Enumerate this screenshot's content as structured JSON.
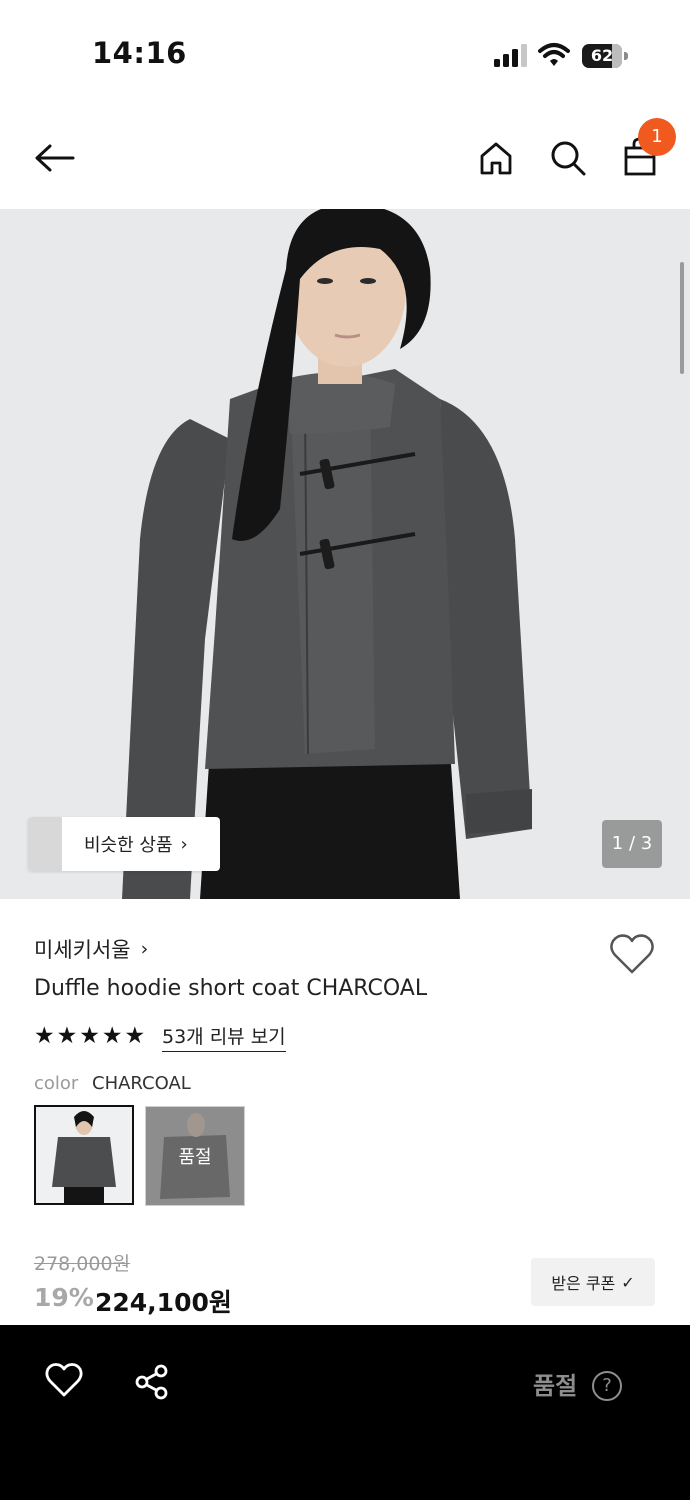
{
  "status_bar": {
    "time": "14:16",
    "battery": "62"
  },
  "header": {
    "cart_count": "1"
  },
  "gallery": {
    "similar_label": "비슷한 상품",
    "page_indicator": "1 / 3"
  },
  "product": {
    "brand": "미세키서울",
    "title": "Duffle hoodie short coat CHARCOAL",
    "rating": 5,
    "review_link": "53개 리뷰 보기",
    "color_label": "color",
    "color_value": "CHARCOAL",
    "swatch_soldout_label": "품절"
  },
  "price": {
    "original": "278,000원",
    "discount": "19%",
    "sale": "224,100원",
    "coupon_label": "받은 쿠폰"
  },
  "bottom_bar": {
    "status": "품절",
    "help": "?"
  }
}
